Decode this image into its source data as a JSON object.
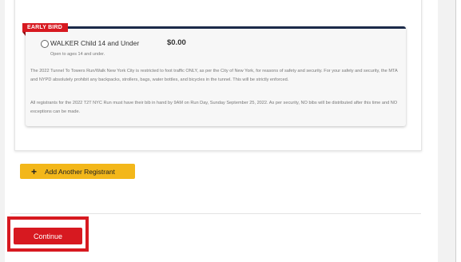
{
  "ticket": {
    "ribbon": "EARLY BIRD",
    "option_label": "WALKER Child 14 and Under",
    "price": "$0.00",
    "note": "Open to ages 14 and under.",
    "paragraph1": "The 2022 Tunnel To Towers Run/Walk New York City is restricted to foot traffic ONLY, as per the City of New York, for reasons of safety and security. For your safety and security, the MTA and NYPD absolutely prohibit any backpacks, strollers, bags, water bottles, and bicycles in the tunnel. This will be strictly enforced.",
    "paragraph2": "All registrants for the 2022 T2T NYC Run must have their bib in hand by 9AM on Run Day, Sunday September 25, 2022. As per security, NO bibs will be distributed after this time and NO exceptions can be made."
  },
  "actions": {
    "add_registrant_icon": "plus-icon",
    "add_registrant_label": "Add Another Registrant",
    "continue_label": "Continue"
  },
  "colors": {
    "brand_red": "#d71920",
    "accent_yellow": "#f3b71a",
    "navy_rule": "#1c2b4a"
  }
}
